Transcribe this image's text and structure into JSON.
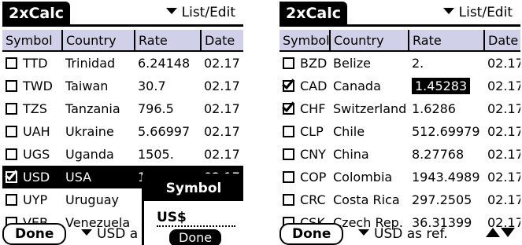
{
  "left": {
    "app_title": "2xCalc",
    "menu_label": "List/Edit",
    "columns": [
      "Symbol",
      "Country",
      "Rate",
      "Date"
    ],
    "rows": [
      {
        "symbol": "TTD",
        "country": "Trinidad",
        "rate": "6.24148",
        "date": "02.17"
      },
      {
        "symbol": "TWD",
        "country": "Taiwan",
        "rate": "30.7",
        "date": "02.17"
      },
      {
        "symbol": "TZS",
        "country": "Tanzania",
        "rate": "796.5",
        "date": "02.17"
      },
      {
        "symbol": "UAH",
        "country": "Ukraine",
        "rate": "5.66997",
        "date": "02.17"
      },
      {
        "symbol": "UGS",
        "country": "Uganda",
        "rate": "1505.",
        "date": "02.17"
      },
      {
        "symbol": "USD",
        "country": "USA",
        "rate": "1",
        "date": "02.17"
      },
      {
        "symbol": "UYP",
        "country": "Uruguay",
        "rate": "",
        "date": ""
      },
      {
        "symbol": "VEB",
        "country": "Venezuela",
        "rate": "",
        "date": ""
      }
    ],
    "done_label": "Done",
    "ref_label": "USD",
    "ref_suffix": "a",
    "dialog": {
      "title": "Symbol",
      "value": "US$",
      "done_label": "Done"
    }
  },
  "right": {
    "app_title": "2xCalc",
    "menu_label": "List/Edit",
    "columns": [
      "Symbol",
      "Country",
      "Rate",
      "Date"
    ],
    "rows": [
      {
        "symbol": "BZD",
        "country": "Belize",
        "rate": "2.",
        "date": "02.17"
      },
      {
        "symbol": "CAD",
        "country": "Canada",
        "rate": "1.45283",
        "date": "02.17"
      },
      {
        "symbol": "CHF",
        "country": "Switzerland",
        "rate": "1.6286",
        "date": "02.17"
      },
      {
        "symbol": "CLP",
        "country": "Chile",
        "rate": "512.69979",
        "date": "02.17"
      },
      {
        "symbol": "CNY",
        "country": "China",
        "rate": "8.27768",
        "date": "02.17"
      },
      {
        "symbol": "COP",
        "country": "Colombia",
        "rate": "1943.4989",
        "date": "02.17"
      },
      {
        "symbol": "CRC",
        "country": "Costa Rica",
        "rate": "297.2505",
        "date": "02.17"
      },
      {
        "symbol": "CSK",
        "country": "Czech Rep.",
        "rate": "36.31399",
        "date": "02.17"
      }
    ],
    "done_label": "Done",
    "ref_label": "USD",
    "ref_suffix": "as ref."
  }
}
